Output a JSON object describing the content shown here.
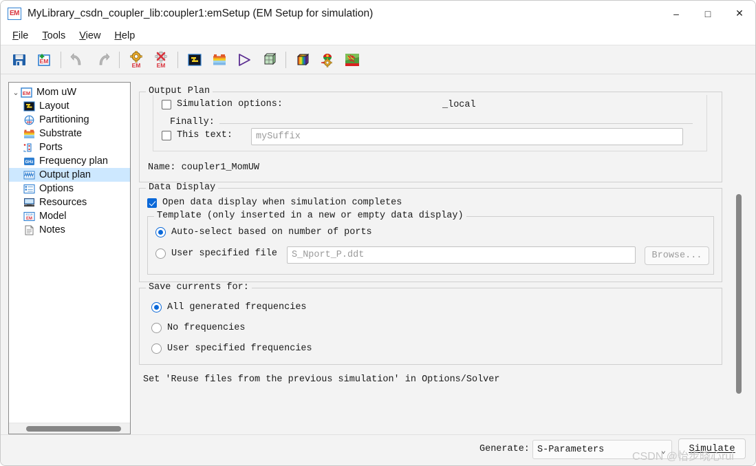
{
  "window": {
    "title": "MyLibrary_csdn_coupler_lib:coupler1:emSetup (EM Setup for simulation)",
    "app_icon_text": "EM",
    "minimize": "–",
    "maximize": "□",
    "close": "✕"
  },
  "menu": [
    {
      "label": "File",
      "mnemonic": "F",
      "rest": "ile"
    },
    {
      "label": "Tools",
      "mnemonic": "T",
      "rest": "ools"
    },
    {
      "label": "View",
      "mnemonic": "V",
      "rest": "iew"
    },
    {
      "label": "Help",
      "mnemonic": "H",
      "rest": "elp"
    }
  ],
  "toolbar": {
    "buttons": [
      {
        "name": "save-icon",
        "title": "Save"
      },
      {
        "name": "save-em-setup-icon",
        "title": "Save EM Setup"
      },
      {
        "name": "undo-icon",
        "title": "Undo"
      },
      {
        "name": "redo-icon",
        "title": "Redo"
      },
      {
        "name": "em-simulation-settings-icon",
        "title": "EM Simulation Settings"
      },
      {
        "name": "em-stop-icon",
        "title": "Stop EM"
      },
      {
        "name": "layout-icon",
        "title": "Layout"
      },
      {
        "name": "substrate-icon",
        "title": "Substrate"
      },
      {
        "name": "run-simulation-icon",
        "title": "Simulate"
      },
      {
        "name": "3d-view-icon",
        "title": "3D View"
      },
      {
        "name": "em-cube-icon",
        "title": "EM Cube"
      },
      {
        "name": "em-model-icon",
        "title": "EM Model"
      },
      {
        "name": "current-visualization-icon",
        "title": "Visualization"
      }
    ]
  },
  "tree": {
    "root": {
      "label": "Mom uW",
      "icon": "em-icon",
      "expanded": true,
      "chevron": "⌄"
    },
    "items": [
      {
        "label": "Layout",
        "icon": "layout-icon",
        "selected": false
      },
      {
        "label": "Partitioning",
        "icon": "partitioning-icon",
        "selected": false
      },
      {
        "label": "Substrate",
        "icon": "substrate-icon",
        "selected": false
      },
      {
        "label": "Ports",
        "icon": "ports-icon",
        "selected": false
      },
      {
        "label": "Frequency plan",
        "icon": "ghz-icon",
        "selected": false
      },
      {
        "label": "Output plan",
        "icon": "output-plan-icon",
        "selected": true
      },
      {
        "label": "Options",
        "icon": "options-icon",
        "selected": false
      },
      {
        "label": "Resources",
        "icon": "resources-icon",
        "selected": false
      },
      {
        "label": "Model",
        "icon": "model-icon",
        "selected": false
      },
      {
        "label": "Notes",
        "icon": "notes-icon",
        "selected": false
      }
    ]
  },
  "output_plan": {
    "group_label": "Output Plan",
    "simulation_options": {
      "label": "Simulation options:",
      "checked": false,
      "value": "_local"
    },
    "finally": {
      "label": "Finally:",
      "this_text_label": "This text:",
      "this_text_checked": false,
      "suffix_placeholder": "mySuffix",
      "suffix_value": ""
    },
    "name_line": "Name: coupler1_MomUW"
  },
  "data_display": {
    "group_label": "Data Display",
    "open_on_complete": {
      "label": "Open data display when simulation completes",
      "checked": true
    },
    "template": {
      "group_label": "Template (only inserted in a new or empty data display)",
      "options": [
        {
          "label": "Auto-select based on number of ports",
          "selected": true
        },
        {
          "label": "User specified file",
          "selected": false
        }
      ],
      "file_placeholder": "S_Nport_P.ddt",
      "file_value": "",
      "browse_label": "Browse..."
    }
  },
  "save_currents": {
    "group_label": "Save currents for:",
    "options": [
      {
        "label": "All generated frequencies",
        "selected": true
      },
      {
        "label": "No frequencies",
        "selected": false
      },
      {
        "label": "User specified frequencies",
        "selected": false
      }
    ]
  },
  "note": "Set 'Reuse files from the previous simulation' in Options/Solver",
  "bottom": {
    "generate_label": "Generate:",
    "generate_value": "S-Parameters",
    "generate_caret": "⌄",
    "simulate_label": "Simulate",
    "simulate_mnemonic": "S",
    "simulate_rest": "imulate"
  },
  "watermark": "CSDN @怡步晓心rui",
  "colors": {
    "accent": "#0a68d8",
    "selection": "#cde8ff",
    "panel": "#f3f3f3",
    "border": "#cfcfcf",
    "scrollbar": "#868686"
  }
}
